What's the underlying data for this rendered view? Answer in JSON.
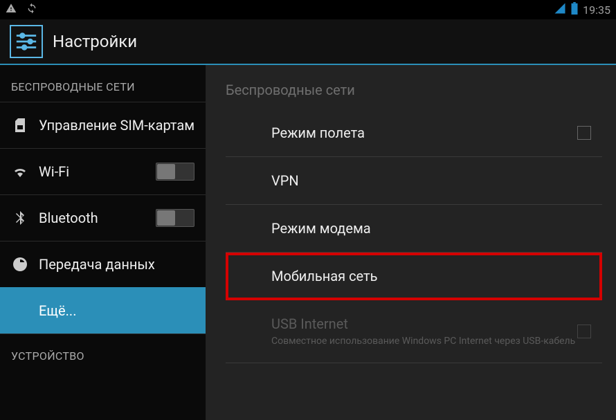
{
  "status_bar": {
    "time": "19:35"
  },
  "title": "Настройки",
  "sidebar": {
    "section_wireless": "БЕСПРОВОДНЫЕ СЕТИ",
    "section_device": "УСТРОЙСТВО",
    "items": {
      "sim": "Управление SIM-картам",
      "wifi": "Wi-Fi",
      "bluetooth": "Bluetooth",
      "data": "Передача данных",
      "more": "Ещё..."
    }
  },
  "detail": {
    "header": "Беспроводные сети",
    "airplane": "Режим полета",
    "vpn": "VPN",
    "tethering": "Режим модема",
    "mobile": "Мобильная сеть",
    "usb_title": "USB Internet",
    "usb_sub": "Совместное использование Windows PC Internet через USB-кабель"
  }
}
